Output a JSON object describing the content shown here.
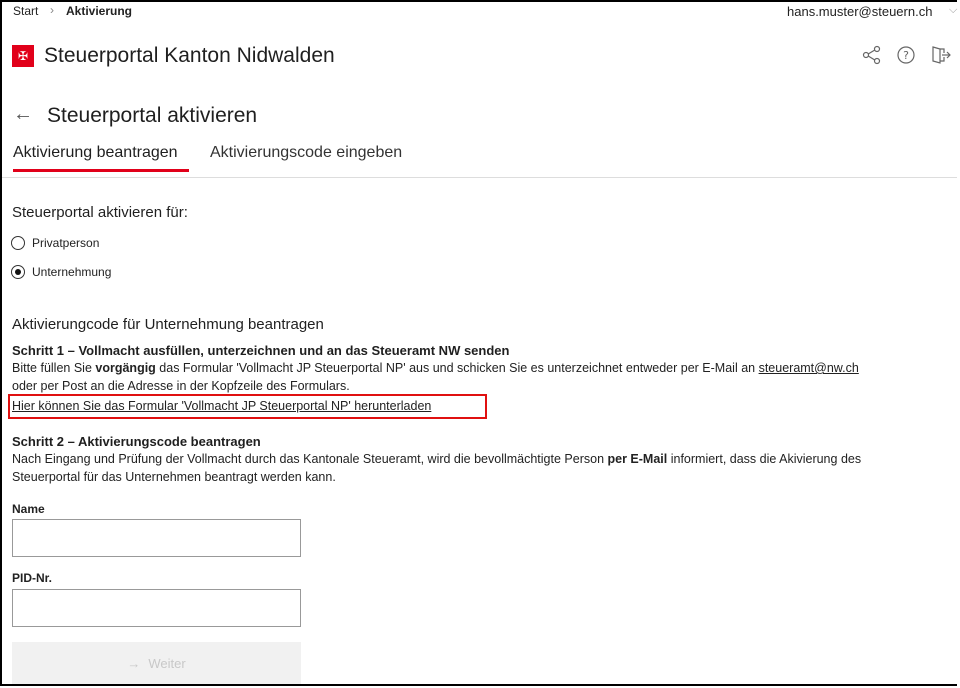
{
  "breadcrumb": {
    "start": "Start",
    "separator": ">",
    "current": "Aktivierung"
  },
  "account": {
    "email": "hans.muster@steuern.ch"
  },
  "header": {
    "app_title": "Steuerportal Kanton Nidwalden",
    "logo_glyph": "✠"
  },
  "icons": {
    "share": "share-icon",
    "help": "help-icon",
    "logout": "logout-icon",
    "back": "back-arrow-icon"
  },
  "page": {
    "title": "Steuerportal aktivieren"
  },
  "tabs": [
    {
      "label": "Aktivierung beantragen",
      "active": true
    },
    {
      "label": "Aktivierungscode eingeben",
      "active": false
    }
  ],
  "form": {
    "activate_for_label": "Steuerportal aktivieren für:",
    "options": [
      {
        "label": "Privatperson",
        "selected": false
      },
      {
        "label": "Unternehmung",
        "selected": true
      }
    ],
    "section_title": "Aktivierungcode für Unternehmung beantragen",
    "step1": {
      "title": "Schritt 1 – Vollmacht ausfüllen, unterzeichnen und an das Steueramt NW senden",
      "text_a": "Bitte füllen Sie ",
      "text_bold": "vorgängig",
      "text_b": " das Formular 'Vollmacht JP Steuerportal NP' aus und schicken Sie es unterzeichnet entweder per E-Mail an ",
      "email_link": "steueramt@nw.ch",
      "text_c": "oder per Post an die Adresse in der Kopfzeile des Formulars.",
      "download_link": "Hier können Sie das Formular 'Vollmacht JP Steuerportal NP' herunterladen"
    },
    "step2": {
      "title": "Schritt 2 – Aktivierungscode beantragen",
      "text_a": "Nach Eingang und Prüfung der Vollmacht durch das Kantonale Steueramt, wird die bevollmächtigte Person ",
      "text_bold": "per E-Mail",
      "text_b": " informiert, dass die Akivierung des",
      "text_c": "Steuerportal für das Unternehmen beantragt werden kann."
    },
    "name_label": "Name",
    "name_value": "",
    "pid_label": "PID-Nr.",
    "pid_value": "",
    "submit_label": "Weiter",
    "submit_icon": "arrow-right-icon"
  },
  "colors": {
    "accent": "#e1001a",
    "highlight_box": "#e01010",
    "disabled_button": "#f1f1f1"
  }
}
